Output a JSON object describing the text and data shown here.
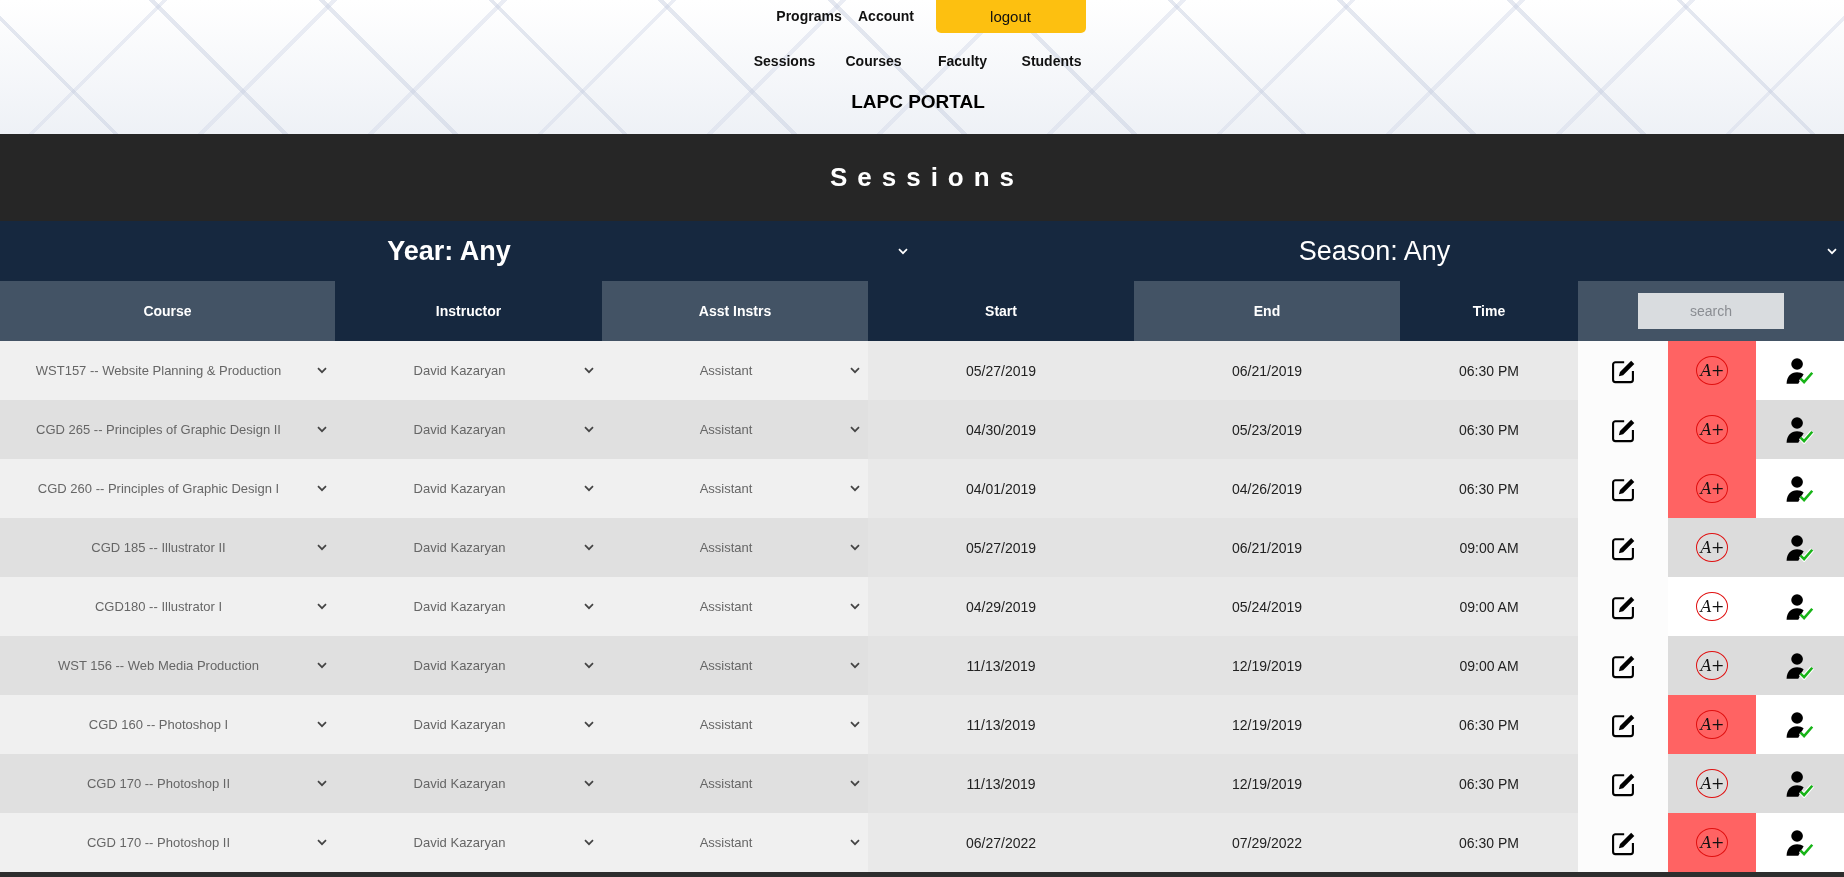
{
  "nav": {
    "top_links": [
      {
        "kind": "link",
        "label": "Programs"
      },
      {
        "kind": "link",
        "label": "Account"
      },
      {
        "kind": "button",
        "label": "logout"
      }
    ],
    "section_links": [
      "Sessions",
      "Courses",
      "Faculty",
      "Students"
    ]
  },
  "portal_title": "LAPC PORTAL",
  "page_title": "Sessions",
  "filters": {
    "year": "Year: Any",
    "season": "Season: Any"
  },
  "table": {
    "columns": [
      "Course",
      "Instructor",
      "Asst Instrs",
      "Start",
      "End",
      "Time"
    ],
    "search": {
      "placeholder": "search"
    },
    "rows": [
      {
        "course": "WST157 -- Website Planning & Production",
        "instructor": "David Kazaryan",
        "assistant": "Assistant",
        "start": "05/27/2019",
        "end": "06/21/2019",
        "time": "06:30 PM",
        "grade_mark": "A+",
        "flagged": true
      },
      {
        "course": "CGD 265 -- Principles of Graphic Design II",
        "instructor": "David Kazaryan",
        "assistant": "Assistant",
        "start": "04/30/2019",
        "end": "05/23/2019",
        "time": "06:30 PM",
        "grade_mark": "A+",
        "flagged": true
      },
      {
        "course": "CGD 260 -- Principles of Graphic Design I",
        "instructor": "David Kazaryan",
        "assistant": "Assistant",
        "start": "04/01/2019",
        "end": "04/26/2019",
        "time": "06:30 PM",
        "grade_mark": "A+",
        "flagged": true
      },
      {
        "course": "CGD 185 -- Illustrator II",
        "instructor": "David Kazaryan",
        "assistant": "Assistant",
        "start": "05/27/2019",
        "end": "06/21/2019",
        "time": "09:00 AM",
        "grade_mark": "A+",
        "flagged": false
      },
      {
        "course": "CGD180 -- Illustrator I",
        "instructor": "David Kazaryan",
        "assistant": "Assistant",
        "start": "04/29/2019",
        "end": "05/24/2019",
        "time": "09:00 AM",
        "grade_mark": "A+",
        "flagged": false
      },
      {
        "course": "WST 156 -- Web Media Production",
        "instructor": "David Kazaryan",
        "assistant": "Assistant",
        "start": "11/13/2019",
        "end": "12/19/2019",
        "time": "09:00 AM",
        "grade_mark": "A+",
        "flagged": false
      },
      {
        "course": "CGD 160 -- Photoshop I",
        "instructor": "David Kazaryan",
        "assistant": "Assistant",
        "start": "11/13/2019",
        "end": "12/19/2019",
        "time": "06:30 PM",
        "grade_mark": "A+",
        "flagged": true
      },
      {
        "course": "CGD 170 -- Photoshop II",
        "instructor": "David Kazaryan",
        "assistant": "Assistant",
        "start": "11/13/2019",
        "end": "12/19/2019",
        "time": "06:30 PM",
        "grade_mark": "A+",
        "flagged": false
      },
      {
        "course": "CGD 170 -- Photoshop II",
        "instructor": "David Kazaryan",
        "assistant": "Assistant",
        "start": "06/27/2022",
        "end": "07/29/2022",
        "time": "06:30 PM",
        "grade_mark": "A+",
        "flagged": true
      }
    ]
  }
}
